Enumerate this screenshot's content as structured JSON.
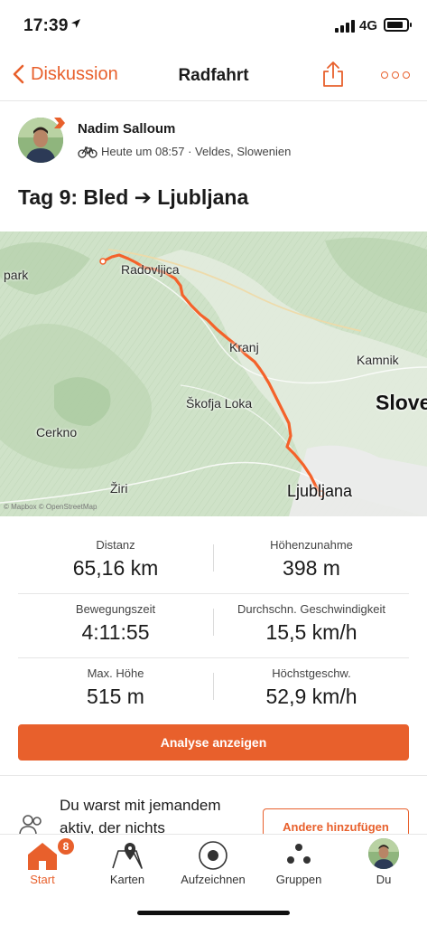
{
  "status_bar": {
    "time": "17:39",
    "network": "4G",
    "battery_level": 0.85,
    "location_icon": "location-arrow-icon"
  },
  "nav": {
    "back_label": "Diskussion",
    "title": "Radfahrt",
    "share_icon": "share-icon",
    "more_icon": "more-dots-icon"
  },
  "athlete": {
    "name": "Nadim Salloum",
    "meta": "Heute um 08:57 · Veldes, Slowenien",
    "activity_icon": "bicycle-icon"
  },
  "activity": {
    "title": "Tag 9: Bled ➔ Ljubljana"
  },
  "map": {
    "labels": {
      "park": "park",
      "radovljica": "Radovljica",
      "kranj": "Kranj",
      "kamnik": "Kamnik",
      "slove": "Slove",
      "skofja_loka": "Škofja Loka",
      "cerkno": "Cerkno",
      "ziri": "Žiri",
      "ljubljana": "Ljubljana"
    },
    "attribution": "© Mapbox © OpenStreetMap",
    "route_color": "#f4622a"
  },
  "stats": [
    {
      "left": {
        "label": "Distanz",
        "value": "65,16 km"
      },
      "right": {
        "label": "Höhenzunahme",
        "value": "398 m"
      }
    },
    {
      "left": {
        "label": "Bewegungszeit",
        "value": "4:11:55"
      },
      "right": {
        "label": "Durchschn. Geschwindigkeit",
        "value": "15,5 km/h"
      }
    },
    {
      "left": {
        "label": "Max. Höhe",
        "value": "515 m"
      },
      "right": {
        "label": "Höchstgeschw.",
        "value": "52,9 km/h"
      }
    }
  ],
  "analyse_button": "Analyse anzeigen",
  "suggestion": {
    "text": "Du warst mit jemandem aktiv, der nichts",
    "button": "Andere hinzufügen",
    "icon": "people-icon"
  },
  "tabs": [
    {
      "label": "Start",
      "icon": "home-icon",
      "badge": "8",
      "active": true
    },
    {
      "label": "Karten",
      "icon": "map-pin-icon"
    },
    {
      "label": "Aufzeichnen",
      "icon": "record-icon"
    },
    {
      "label": "Gruppen",
      "icon": "groups-icon"
    },
    {
      "label": "Du",
      "icon": "profile-avatar"
    }
  ],
  "colors": {
    "accent": "#e8602c",
    "text": "#1b1b1b",
    "divider": "#e6e6e6"
  }
}
